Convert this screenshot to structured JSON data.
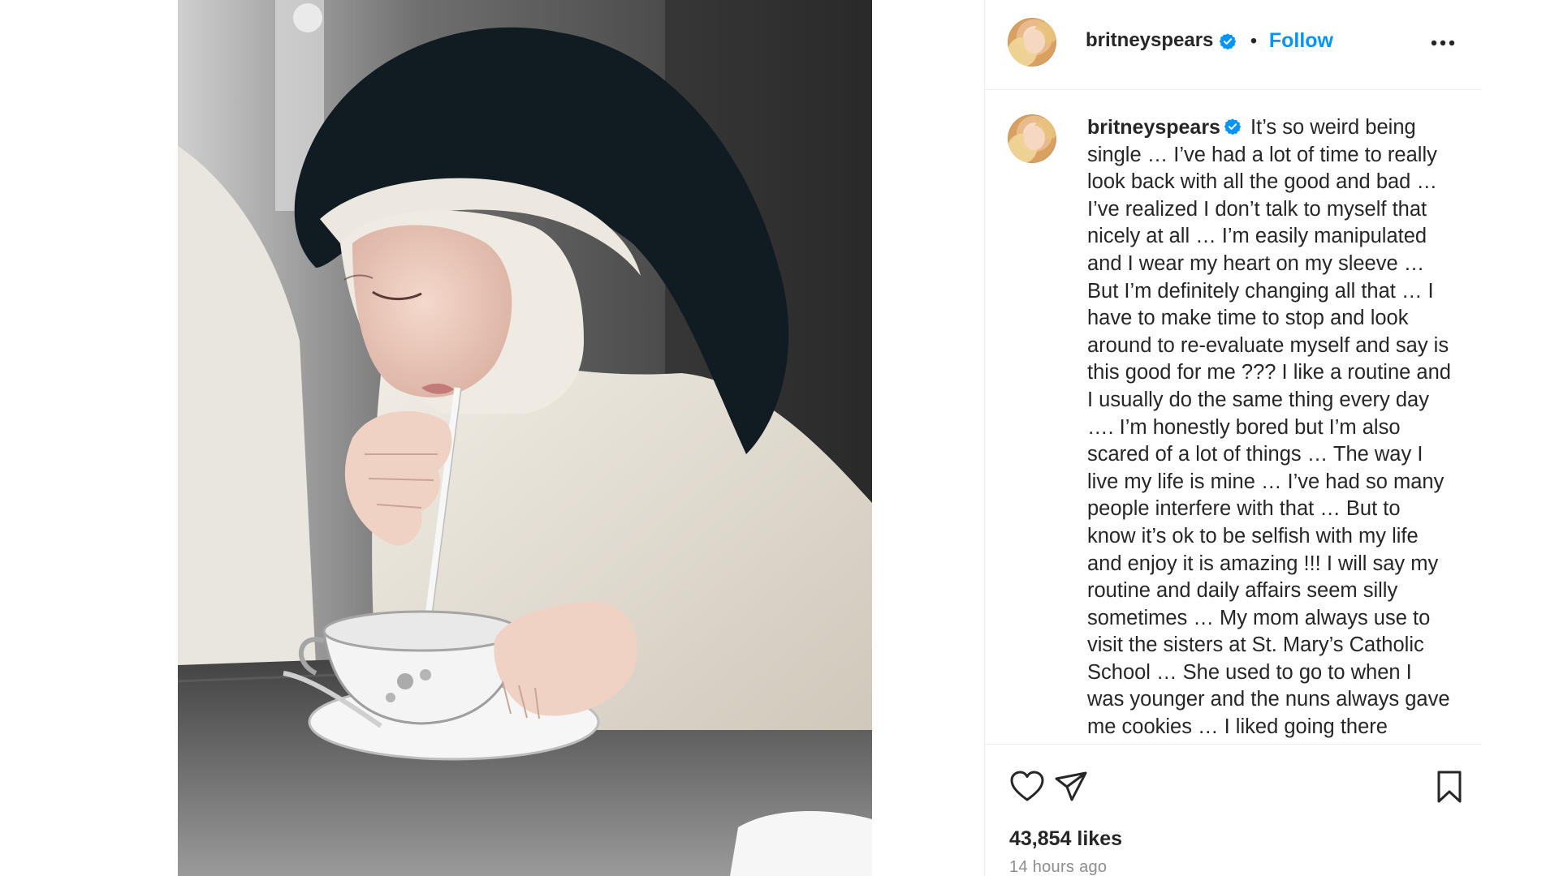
{
  "post": {
    "username": "britneyspears",
    "separator": "•",
    "follow_label": "Follow",
    "caption": "It’s so weird being single … I’ve had a lot of time to really look back with all the good and bad … I’ve realized I don’t talk to myself that nicely at all … I’m easily manipulated and I wear my heart on my sleeve … But I’m definitely changing all that … I have to make time to stop and look around to re-evaluate myself and say is this good for me ??? I like a routine and I usually do the same thing every day …. I’m honestly bored but I’m also scared of a lot of things … The way I live my life is mine … I’ve had so many people interfere with that … But to know it’s ok to be selfish with my life and enjoy it is amazing !!! I will say my routine and daily affairs seem silly sometimes … My mom always use to visit the sisters at St. Mary’s Catholic School … She used to go to when I was younger and the nuns always gave me cookies … I liked going there",
    "likes": "43,854 likes",
    "time_ago": "14 hours ago"
  },
  "icons": {
    "verified": "verified-badge-icon",
    "more": "more-options-icon",
    "like": "heart-icon",
    "share": "paper-plane-icon",
    "save": "bookmark-icon"
  },
  "colors": {
    "accent": "#0095f6",
    "verified": "#0095f6",
    "text": "#262626",
    "muted": "#8e8e8e",
    "divider": "#efefef"
  }
}
